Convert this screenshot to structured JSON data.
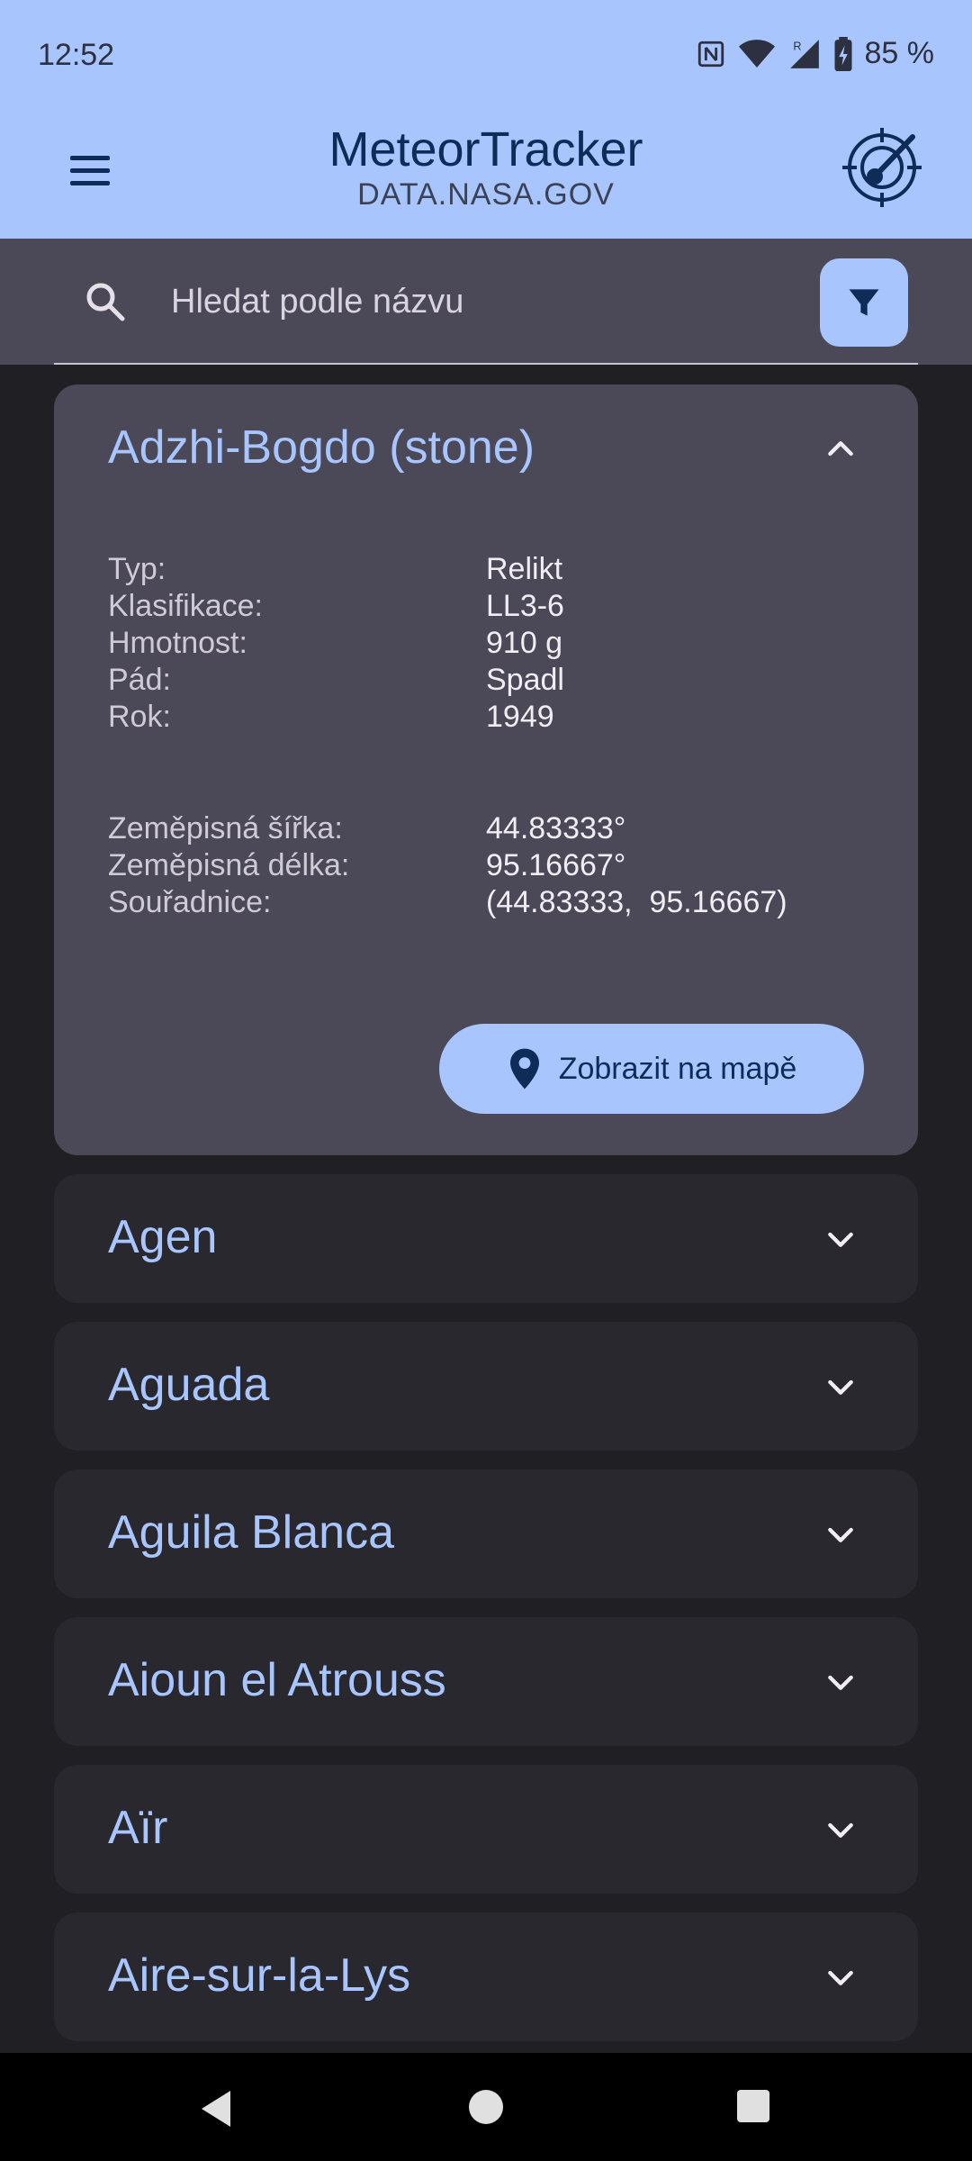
{
  "status": {
    "time": "12:52",
    "battery": "85 %"
  },
  "app": {
    "title": "MeteorTracker",
    "subtitle": "DATA.NASA.GOV"
  },
  "search": {
    "placeholder": "Hledat podle názvu",
    "value": ""
  },
  "expanded": {
    "title": "Adzhi-Bogdo (stone)",
    "details": [
      {
        "label": "Typ:",
        "value": "Relikt"
      },
      {
        "label": "Klasifikace:",
        "value": "LL3-6"
      },
      {
        "label": "Hmotnost:",
        "value": "910 g"
      },
      {
        "label": "Pád:",
        "value": "Spadl"
      },
      {
        "label": "Rok:",
        "value": "1949"
      }
    ],
    "coords": [
      {
        "label": "Zeměpisná šířka:",
        "value": "44.83333°"
      },
      {
        "label": "Zeměpisná délka:",
        "value": "95.16667°"
      },
      {
        "label": "Souřadnice:",
        "value": "(44.83333,  95.16667)"
      }
    ],
    "map_button": "Zobrazit na mapě"
  },
  "items": [
    {
      "title": "Agen"
    },
    {
      "title": "Aguada"
    },
    {
      "title": "Aguila Blanca"
    },
    {
      "title": "Aioun el Atrouss"
    },
    {
      "title": "Aïr"
    },
    {
      "title": "Aire-sur-la-Lys"
    }
  ],
  "colors": {
    "accent": "#a8c5fd",
    "surface": "#4b4858",
    "card": "#29282f",
    "background": "#1f1f24"
  }
}
